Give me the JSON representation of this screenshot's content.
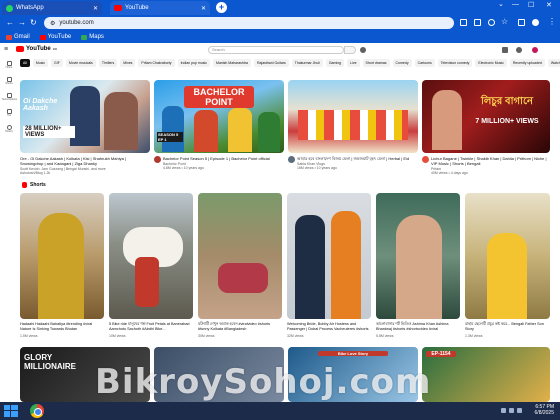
{
  "browser": {
    "tabs": [
      {
        "label": "WhatsApp",
        "icon": "whatsapp-icon"
      },
      {
        "label": "YouTube",
        "icon": "youtube-icon"
      }
    ],
    "url": "youtube.com",
    "bookmarks": [
      "Gmail",
      "YouTube",
      "Maps"
    ]
  },
  "youtube": {
    "logo": "YouTube",
    "logo_region": "BD",
    "search_placeholder": "Search",
    "chips": [
      "All",
      "Music",
      "GIF",
      "Movie musicals",
      "Thrillers",
      "Mixes",
      "Pritam Chakraborty",
      "Indian pop music",
      "Manish Maharashtra",
      "Rajasthani Guitars",
      "Thakurmar Jhuli",
      "Gaming",
      "Live",
      "Short dramas",
      "Comedy",
      "Cartoons",
      "Television comedy",
      "Electronic Music",
      "Recently uploaded",
      "Watched"
    ],
    "sidebar": [
      {
        "label": "Home"
      },
      {
        "label": "Shorts"
      },
      {
        "label": "Subscriptions"
      },
      {
        "label": "You"
      },
      {
        "label": "History"
      }
    ],
    "videos": [
      {
        "title": "Ore - Oi Dakche Aakash | Kolkata | Kisi | Shahrukh Mahiya | Snowingdrop | and Kadagani | Ziga Dhanky",
        "meta": "Scott Kevich: Jam Guzzang | Bengal Munshi, and more",
        "meta2": "Ashutosh/Blog 1.2k",
        "thumb_text": "Oi Dakche Aakash",
        "badge": "28 MILLION+ VIEWS"
      },
      {
        "title": "Bachelor Point Season 5 | Episode 1 | Bachelor Point official",
        "meta": "Bachelor Point",
        "meta2": "4.8M views • 10 years ago",
        "thumb_text": "BACHELOR POINT",
        "badge": "SEASON 5 EP 1"
      },
      {
        "title": "আবার হবে বাংলাদেশ বিজয় মেলা | জমজমাট বৃহৎ মেলা | Herbal | Eid Vlog Bohat Huzz Nhi Hbo",
        "meta": "Sabia Khan Vlogs",
        "meta2": "16M views • 10 years ago",
        "thumb_text": "",
        "badge": ""
      },
      {
        "title": "Lichur Bagane | Twinkle | Shakib Khan | Dahlia | Prithom | Niche | VIP Music | Shorts | Bengali",
        "meta": "Pritam",
        "meta2": "40M views • 4 days ago",
        "thumb_text": "লিচুর বাগানে",
        "badge": "7 MILLION+ VIEWS"
      }
    ],
    "shorts_label": "Shorts",
    "shorts": [
      {
        "title": "Hadaahi Hadaahi Bahatiya #trending #viral Nature Is Sinking Towards Bhutan",
        "views": "1.5M views"
      },
      {
        "title": "5 Bike ride মানুষের গল্প Fruit Petals at Banerabad Aamchotu Sachoth #Abdhi Bike...",
        "views": "10M views"
      },
      {
        "title": "ঘটনাটি দেখুন অবাক হবেন #viralvideo #shorts #funny Kolkata #Bangladesh",
        "views": "30M views"
      },
      {
        "title": "Welcoming Bride, Bobby Air Hostess and Passenger | Dubai Process Vacheuteres #shorts",
        "views": "32M views"
      },
      {
        "title": "ভালোবাসার শর্ট ভিডিও Ashima Khan Ashima Bhardwaj #shorts #shortsvideo #viral",
        "views": "5.8M views"
      },
      {
        "title": "রাহাম ছেলেটি প্রচুর কষ্ট করে... Bengali Father Son Story",
        "views": "1.3M views"
      }
    ],
    "bottom_row": [
      {
        "thumb_text": "GLORY MILLIONAIRE"
      },
      {
        "thumb_text": ""
      },
      {
        "thumb_text": "Bike Love Story"
      },
      {
        "thumb_text": ""
      },
      {
        "thumb_text": "EP-1154"
      }
    ]
  },
  "watermark": "BikroySohoj.com",
  "taskbar": {
    "time": "6:57 PM",
    "date": "6/8/2025"
  }
}
